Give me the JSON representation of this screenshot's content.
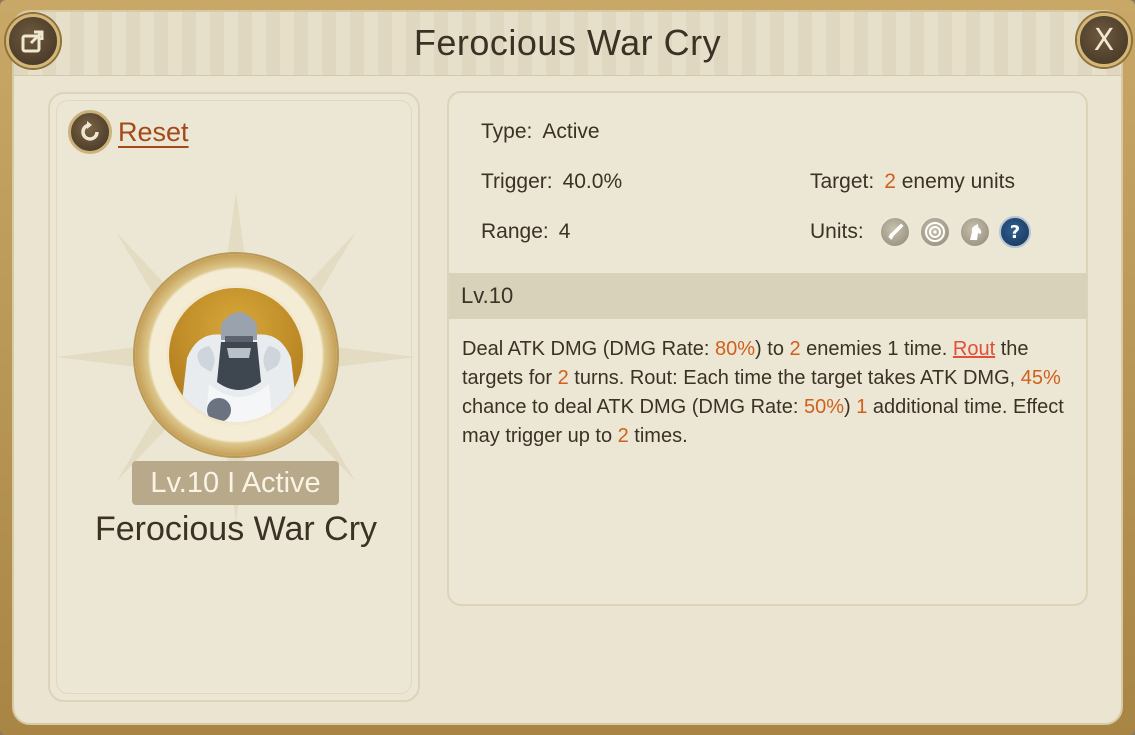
{
  "header": {
    "title": "Ferocious War Cry",
    "close_label": "X"
  },
  "left_panel": {
    "reset_label": "Reset",
    "badge": "Lv.10 I Active",
    "skill_name": "Ferocious War Cry"
  },
  "stats": {
    "type_label": "Type:",
    "type_value": "Active",
    "trigger_label": "Trigger:",
    "trigger_value": "40.0%",
    "range_label": "Range:",
    "range_value": "4",
    "target_label": "Target:",
    "target_count": "2",
    "target_suffix": "enemy units",
    "units_label": "Units:",
    "units_icons": [
      "sword-icon",
      "target-icon",
      "horse-icon",
      "question-icon"
    ],
    "unknown_unit_glyph": "?"
  },
  "level_header": "Lv.10",
  "description": {
    "p1": "Deal ATK DMG (DMG Rate: ",
    "v1": "80%",
    "p2": ") to ",
    "v2": "2",
    "p3": " enemies 1 time. ",
    "link": "Rout",
    "p4": " the targets for ",
    "v3": "2",
    "p5": " turns. Rout: Each time the target takes ATK DMG, ",
    "v4": "45%",
    "p6": " chance to deal ATK DMG (DMG Rate: ",
    "v5": "50%",
    "p7": ") ",
    "v6": "1",
    "p8": " additional time. Effect may trigger up to ",
    "v7": "2",
    "p9": " times."
  },
  "colors": {
    "highlight": "#d0601c",
    "link": "#e0503a",
    "panel": "#eae4d1",
    "frame": "#b8944f"
  }
}
